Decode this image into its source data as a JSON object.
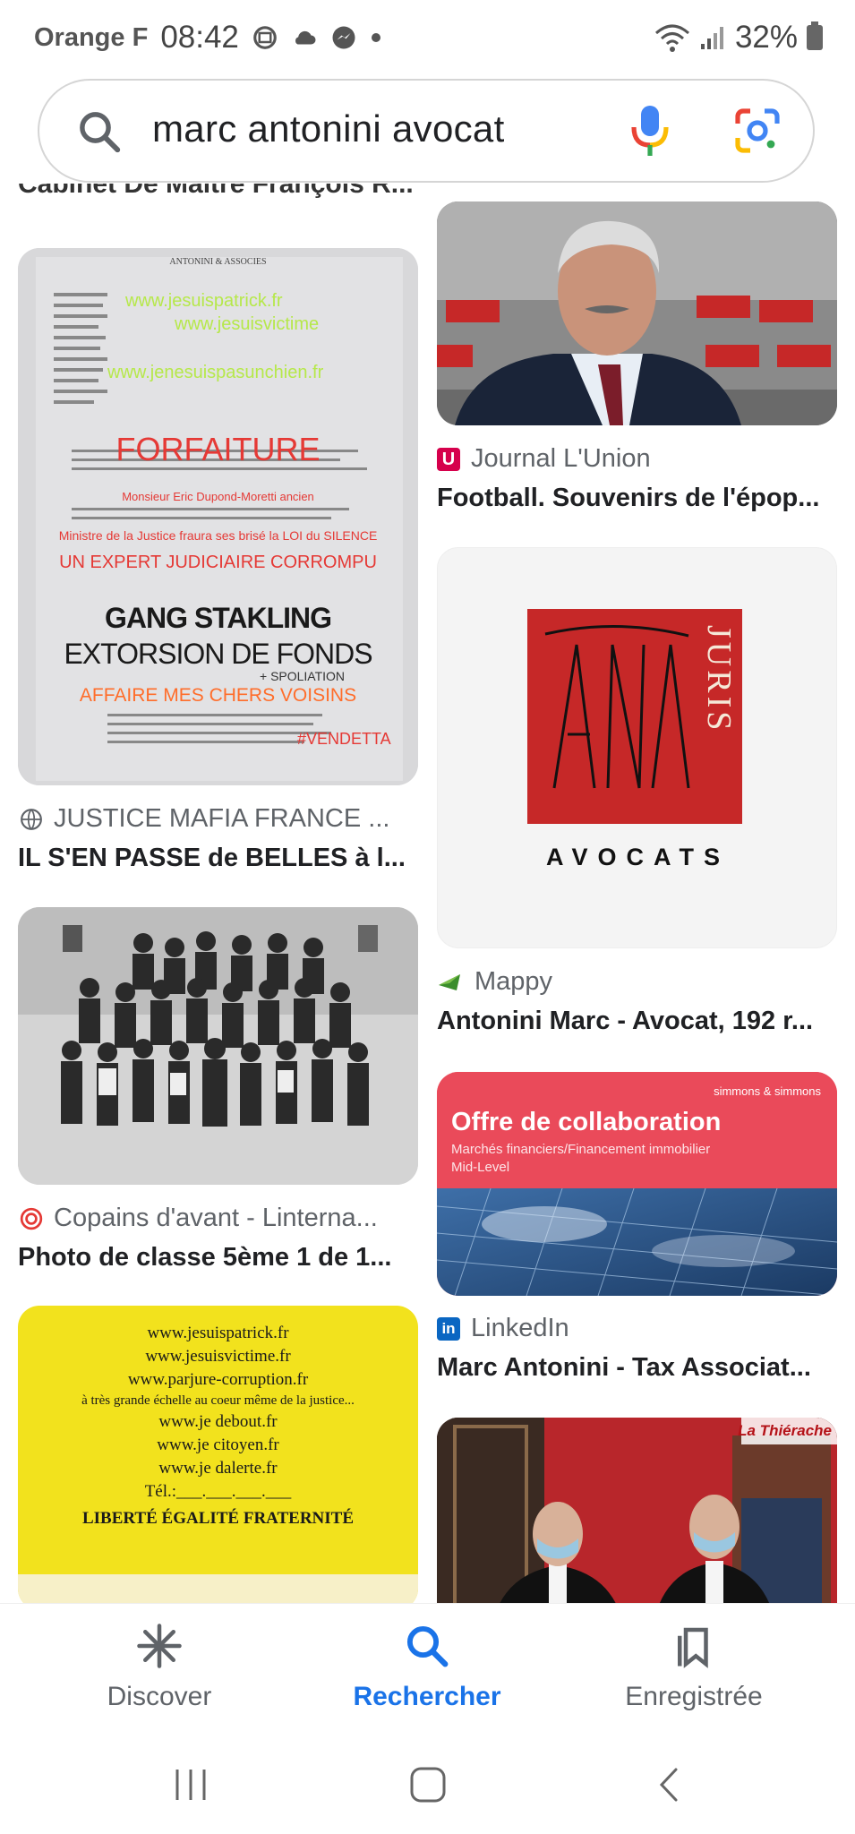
{
  "status_bar": {
    "carrier": "Orange F",
    "time": "08:42",
    "battery": "32%"
  },
  "search": {
    "query": "marc antonini avocat"
  },
  "results": {
    "partial_top_title": "Cabinet De Maître François R...",
    "left": [
      {
        "source": "JUSTICE MAFIA FRANCE ...",
        "title": "IL S'EN PASSE de BELLES à l...",
        "image": {
          "lines": [
            "www.jesuispatrick.fr",
            "www.jesuisvictime",
            "www.jenesuispasunchien.fr",
            "FORFAITURE",
            "Monsieur Eric Dupond-Moretti ancien",
            "Ministre de la Justice fraura ses brisé la LOI du SILENCE",
            "UN EXPERT JUDICIAIRE CORROMPU",
            "GANG STAKLING",
            "EXTORSION DE FONDS",
            "+ SPOLIATION",
            "AFFAIRE MES CHERS VOISINS",
            "#VENDETTA"
          ],
          "header": "ANTONINI & ASSOCIES"
        }
      },
      {
        "source": "Copains d'avant - Linterna...",
        "title": "Photo de classe 5ème 1 de 1..."
      },
      {
        "source": "",
        "title": "",
        "image": {
          "lines": [
            "www.jesuispatrick.fr",
            "www.jesuisvictime.fr",
            "www.parjure-corruption.fr",
            "à très grande échelle au coeur même de la justice...",
            "www.je   debout.fr",
            "www.je   citoyen.fr",
            "www.je   dalerte.fr",
            "Tél.:___.___.___.___",
            "LIBERTÉ ÉGALITÉ FRATERNITÉ"
          ]
        }
      }
    ],
    "right": [
      {
        "source": "Journal L'Union",
        "title": "Football. Souvenirs de l'épop..."
      },
      {
        "source": "Mappy",
        "title": "Antonini Marc - Avocat, 192 r...",
        "image": {
          "logo_text": "JURIS",
          "caption": "AVOCATS"
        }
      },
      {
        "source": "LinkedIn",
        "title": "Marc Antonini - Tax Associat...",
        "image": {
          "brand": "simmons & simmons",
          "headline": "Offre de collaboration",
          "sub1": "Marchés financiers/Financement immobilier",
          "sub2": "Mid-Level"
        }
      },
      {
        "source": "",
        "title": "",
        "image": {
          "watermark": "La Thiérache"
        }
      }
    ]
  },
  "bottom_nav": {
    "items": [
      {
        "label": "Discover",
        "icon": "asterisk-icon"
      },
      {
        "label": "Rechercher",
        "icon": "search-icon"
      },
      {
        "label": "Enregistrée",
        "icon": "bookmarks-icon"
      }
    ]
  },
  "colors": {
    "accent": "#1a73e8",
    "union_red": "#d6004c",
    "juris_red": "#c62828",
    "linkedin_blue": "#0a66c2",
    "offer_red": "#ea4a5a"
  }
}
